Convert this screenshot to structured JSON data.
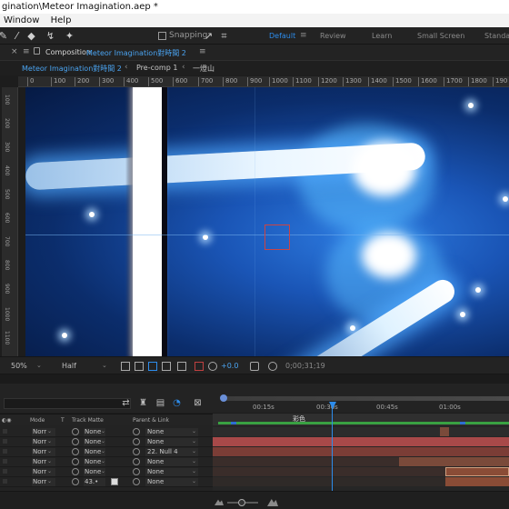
{
  "window": {
    "title": "gination\\Meteor Imagination.aep *",
    "menus": [
      "Window",
      "Help"
    ]
  },
  "toolbar": {
    "tools": [
      "pen-tool-icon",
      "eraser-icon",
      "puppet-pin-icon",
      "pin-icon"
    ],
    "snapping_label": "Snapping",
    "workspaces": [
      "Default",
      "Review",
      "Learn",
      "Small Screen",
      "Standar"
    ],
    "active_workspace": "Default"
  },
  "composition_panel": {
    "prefix": "Composition",
    "name": "Meteor Imagination對時間 2"
  },
  "breadcrumbs": [
    "Meteor Imagination對時間 2",
    "Pre-comp 1",
    "一燈山"
  ],
  "ruler_ticks": [
    "0",
    "100",
    "200",
    "300",
    "400",
    "500",
    "600",
    "700",
    "800",
    "900",
    "1000",
    "1100",
    "1200",
    "1300",
    "1400",
    "1500",
    "1600",
    "1700",
    "1800",
    "190"
  ],
  "ruler_left_ticks": [
    "100",
    "200",
    "300",
    "400",
    "500",
    "600",
    "700",
    "800",
    "900",
    "1000",
    "1100"
  ],
  "viewer_controls": {
    "zoom": "50%",
    "resolution": "Half",
    "exposure": "+0.0",
    "timecode": "0;00;31;19"
  },
  "timeline": {
    "time_ticks": [
      "00:15s",
      "00:30s",
      "00:45s",
      "01:00s"
    ],
    "work_area_label": "彩色",
    "columns": {
      "mode": "Mode",
      "t": "T",
      "track_matte": "Track Matte",
      "parent_link": "Parent & Link"
    },
    "rows": [
      {
        "mode": "Norr",
        "track_matte": "None",
        "parent": "None"
      },
      {
        "mode": "Norr",
        "track_matte": "None",
        "parent": "None"
      },
      {
        "mode": "Norr",
        "track_matte": "None",
        "parent": "22. Null 4"
      },
      {
        "mode": "Norr",
        "track_matte": "None",
        "parent": "None"
      },
      {
        "mode": "Norr",
        "track_matte": "None",
        "parent": "None"
      },
      {
        "mode": "Norr",
        "track_matte": "43.•",
        "parent": "None"
      }
    ],
    "track_colors": [
      "#a84949",
      "#a84949",
      "#7a4a3a",
      "#7a4a3a",
      "#7a4a3a",
      "#8a4c36"
    ]
  },
  "colors": {
    "accent": "#2d8ceb",
    "workarea_green": "#39a142",
    "track_red": "#a84949"
  }
}
